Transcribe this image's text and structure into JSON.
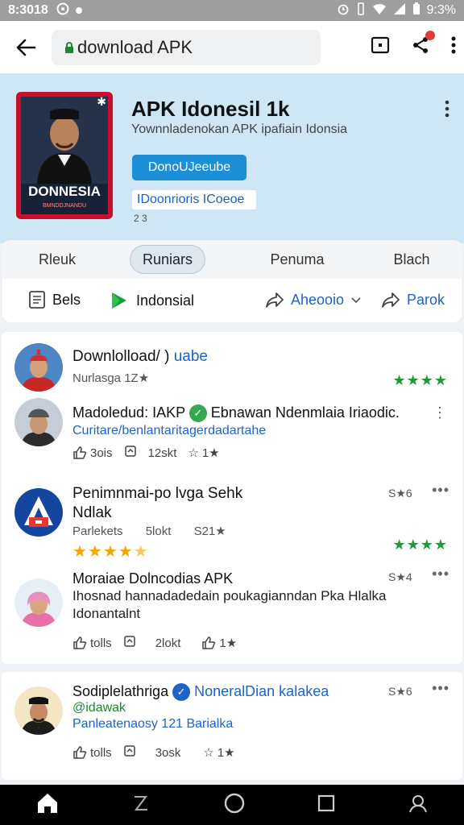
{
  "status": {
    "time": "8:3018",
    "battery": "9:3%"
  },
  "browser": {
    "url": "download APK"
  },
  "app": {
    "poster_word": "DONNESIA",
    "poster_tag": "BMNDDJNANDU",
    "title": "APK Idonesil 1k",
    "subtitle": "Yownnladenokan APK ipafiain Idonsia",
    "download_label": "DonoUJeeube",
    "chip_label": "IDoonrioris ICoeoe",
    "version": "2 3"
  },
  "tabs": [
    "Rleuk",
    "Runiars",
    "Penuma",
    "Blach"
  ],
  "actions": {
    "bels": "Bels",
    "indonesia": "Indonsial",
    "ahecodo": "Aheooio",
    "parok": "Parok"
  },
  "posts": [
    {
      "title": "Downlolload/ )",
      "title_link": "uabe",
      "meta": "Nurlasga 1Z★"
    },
    {
      "title": "Madoledud: IAKP",
      "title_link": "Ebnawan Ndenmlaia Iriaodic.",
      "desc": "Curitare/benlantaritagerdadartahe",
      "stat1": "3ois",
      "stat2": "12skt",
      "stat3": "1★"
    },
    {
      "title": "Penimnmai-po lvga Sehk",
      "title2": "Ndlak",
      "meta": "Parlekets",
      "meta2": "5lokt",
      "meta3": "S21★",
      "count": "S★6"
    },
    {
      "title": "Moraiae Dolncodias APK",
      "desc": "Ihosnad hannadadedain poukagianndan Pka Hlalka",
      "desc2": "Idonantalnt",
      "count": "S★4",
      "stat1": "tolls",
      "stat2": "2lokt",
      "stat3": "1★"
    },
    {
      "title": "Sodiplelathriga",
      "title_link": "NoneralDian kalakea",
      "title2": "@idawak",
      "meta": "Panleatenaosy 121 Barialka",
      "count": "S★6",
      "stat1": "tolls",
      "stat2": "3osk",
      "stat3": "1★"
    }
  ],
  "colors": {
    "accent": "#1e64c8",
    "download": "#1d8fd6",
    "hero_bg": "#cfe6f5",
    "verified": "#1a8a2e",
    "rating_green": "#1e9a3a",
    "rating_gold": "#f2a600"
  }
}
